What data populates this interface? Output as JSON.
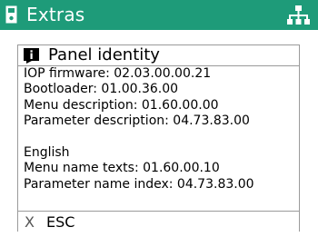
{
  "title_bar": {
    "title": "Extras",
    "background_color": "#1e9b79",
    "left_icon": "device-icon",
    "right_icon": "network-icon"
  },
  "dialog": {
    "title": "Panel identity",
    "icon": "info-icon",
    "lines": [
      "IOP firmware: 02.03.00.00.21",
      "Bootloader: 01.00.36.00",
      "Menu description: 01.60.00.00",
      "Parameter description: 04.73.83.00",
      "",
      "English",
      "Menu name texts: 01.60.00.10",
      "Parameter name index: 04.73.83.00"
    ]
  },
  "footer": {
    "key": "X",
    "label": "ESC"
  }
}
